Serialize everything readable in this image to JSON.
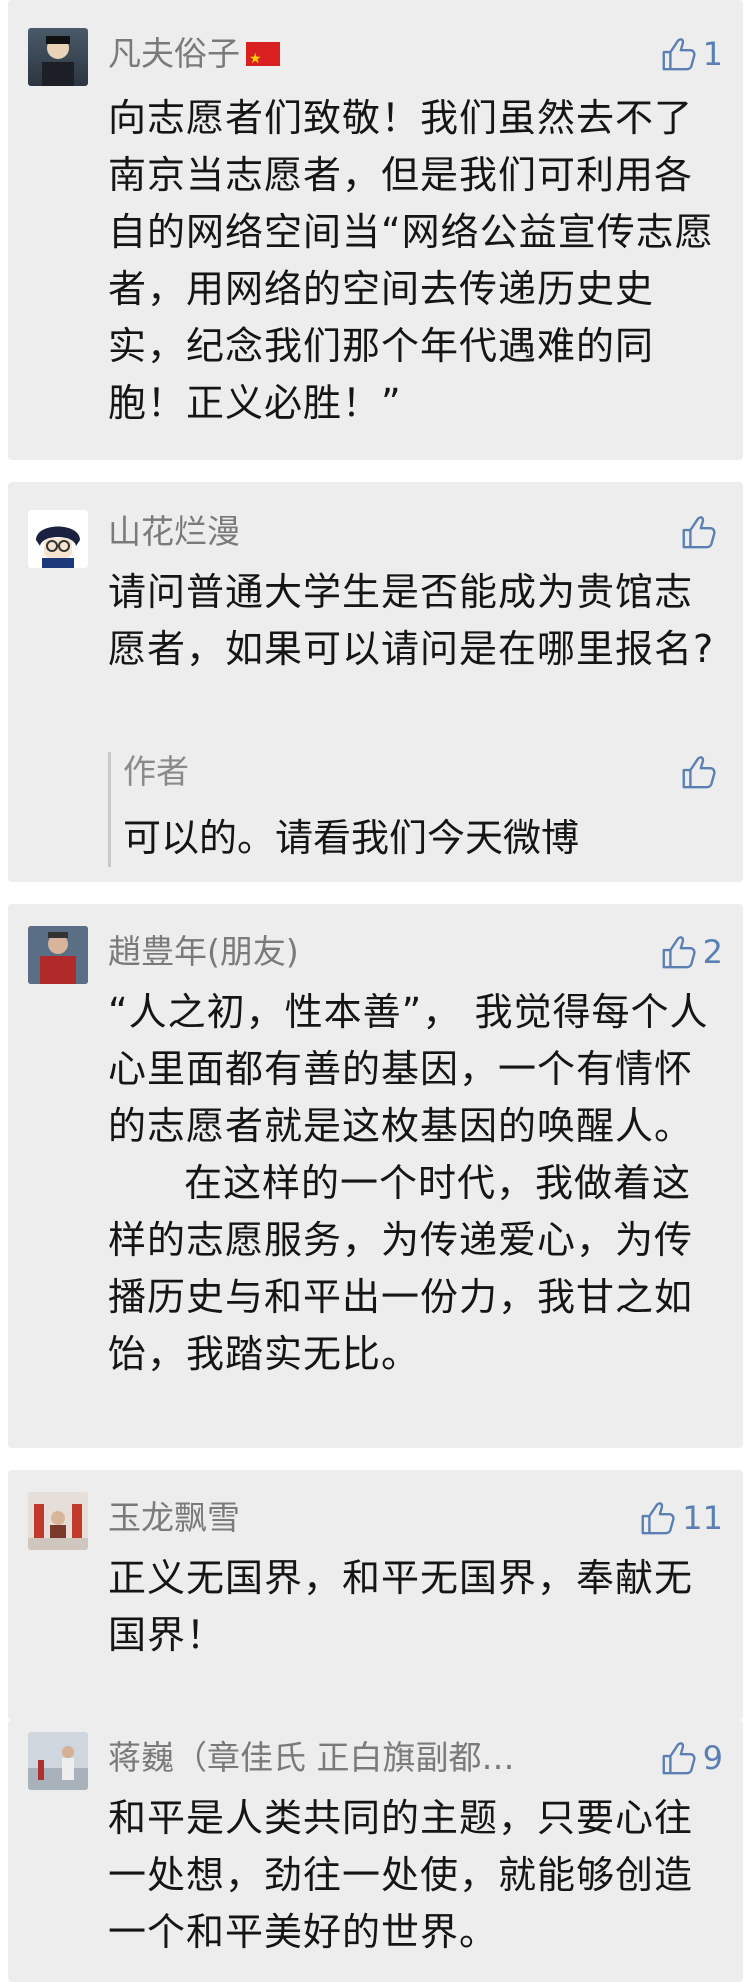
{
  "comments": [
    {
      "name": "凡夫俗子",
      "flag_icon": "china-flag",
      "likes": "1",
      "paragraphs": [
        "向志愿者们致敬！我们虽然去不了南京当志愿者，但是我们可利用各自的网络空间当“网络公益宣传志愿者，用网络的空间去传递历史史实，纪念我们那个年代遇难的同胞！正义必胜！”"
      ]
    },
    {
      "name": "山花烂漫",
      "likes": "",
      "paragraphs": [
        "请问普通大学生是否能成为贵馆志愿者，如果可以请问是在哪里报名?"
      ],
      "reply": {
        "name": "作者",
        "text": "可以的。请看我们今天微博",
        "likes": ""
      }
    },
    {
      "name": "趙豊年(朋友)",
      "likes": "2",
      "paragraphs": [
        "“人之初，性本善”， 我觉得每个人心里面都有善的基因，一个有情怀的志愿者就是这枚基因的唤醒人。",
        "在这样的一个时代，我做着这样的志愿服务，为传递爱心，为传播历史与和平出一份力，我甘之如饴，我踏实无比。"
      ]
    },
    {
      "name": "玉龙飘雪",
      "likes": "11",
      "paragraphs": [
        "正义无国界，和平无国界，奉献无国界！"
      ]
    },
    {
      "name": "蒋巍（章佳氏 正白旗副都…",
      "likes": "9",
      "paragraphs": [
        "和平是人类共同的主题，只要心往一处想，劲往一处使，就能够创造一个和平美好的世界。"
      ]
    }
  ],
  "colors": {
    "card_bg": "#ededed",
    "name": "#7a7a7a",
    "like": "#5b7fb3",
    "text": "#151515"
  },
  "icons": {
    "like": "thumbs-up-icon"
  }
}
